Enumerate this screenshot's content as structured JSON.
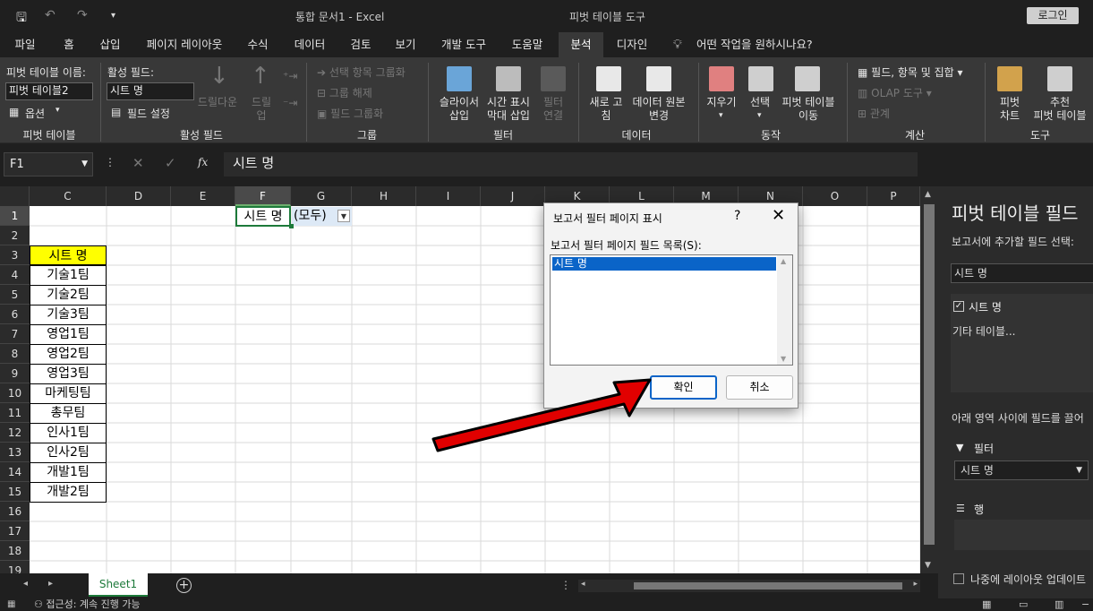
{
  "titlebar": {
    "document_title": "통합 문서1  -  Excel",
    "context_title": "피벗 테이블 도구",
    "login": "로그인"
  },
  "tabs": [
    "파일",
    "홈",
    "삽입",
    "페이지 레이아웃",
    "수식",
    "데이터",
    "검토",
    "보기",
    "개발 도구",
    "도움말",
    "분석",
    "디자인"
  ],
  "tell_me": "어떤 작업을 원하시나요?",
  "ribbon": {
    "pivot_name_label": "피벗 테이블 이름:",
    "pivot_name_value": "피벗 테이블2",
    "options_label": "옵션",
    "group_pivot": "피벗 테이블",
    "active_field_label": "활성 필드:",
    "active_field_value": "시트 명",
    "field_settings": "필드 설정",
    "drill_down": "드릴다운",
    "drill_up": "드릴\n업",
    "group_active": "활성 필드",
    "group_selection": "선택 항목 그룹화",
    "ungroup": "그룹 해제",
    "group_field": "필드 그룹화",
    "group_group": "그룹",
    "slicer": "슬라이서\n삽입",
    "timeline": "시간 표시\n막대 삽입",
    "filter_conn": "필터\n연결",
    "group_filter": "필터",
    "refresh": "새로 고\n침",
    "change_source": "데이터 원본\n변경",
    "group_data": "데이터",
    "clear": "지우기",
    "select": "선택",
    "move_pivot": "피벗 테이블\n이동",
    "group_action": "동작",
    "fields_items": "필드, 항목 및 집합",
    "olap": "OLAP 도구",
    "relations": "관계",
    "group_calc": "계산",
    "pivot_chart": "피벗\n차트",
    "recommended": "추천\n피벗 테이블",
    "group_tools": "도구"
  },
  "formula_bar": {
    "name_box": "F1",
    "fx": "fx",
    "formula": "시트 명"
  },
  "grid": {
    "columns": [
      "C",
      "D",
      "E",
      "F",
      "G",
      "H",
      "I",
      "J",
      "K",
      "L",
      "M",
      "N",
      "O",
      "P"
    ],
    "rows": [
      "1",
      "2",
      "3",
      "4",
      "5",
      "6",
      "7",
      "8",
      "9",
      "10",
      "11",
      "12",
      "13",
      "14",
      "15",
      "16",
      "17",
      "18",
      "19"
    ],
    "f1": "시트 명",
    "g1": "(모두)",
    "c3_header": "시트 명",
    "list": [
      "기술1팀",
      "기술2팀",
      "기술3팀",
      "영업1팀",
      "영업2팀",
      "영업3팀",
      "마케팅팀",
      "총무팀",
      "인사1팀",
      "인사2팀",
      "개발1팀",
      "개발2팀"
    ]
  },
  "sheet_tab": "Sheet1",
  "status": "접근성: 계속 진행 가능",
  "pane": {
    "title": "피벗 테이블 필드",
    "choose": "보고서에 추가할 필드 선택:",
    "search": "시트 명",
    "field1": "시트 명",
    "other": "기타 테이블...",
    "drag": "아래 영역 사이에 필드를 끌어",
    "filter_label": "필터",
    "filter_value": "시트 명",
    "rows_label": "행",
    "defer": "나중에 레이아웃 업데이트"
  },
  "dialog": {
    "title": "보고서 필터 페이지 표시",
    "help": "?",
    "close": "✕",
    "list_label": "보고서 필터 페이지 필드 목록(S):",
    "items": [
      "시트 명"
    ],
    "ok": "확인",
    "cancel": "취소"
  },
  "colors": {
    "accent_green": "#1d7a3a",
    "highlight_yellow": "#ffff00",
    "selection_blue": "#0a64c8",
    "arrow_red": "#e10000"
  }
}
